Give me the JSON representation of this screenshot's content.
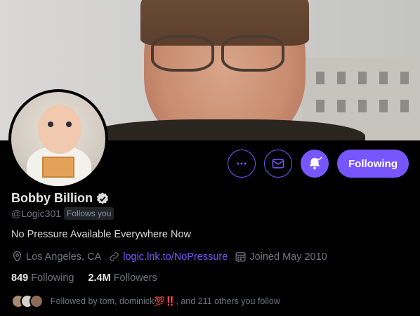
{
  "profile": {
    "display_name": "Bobby Billion",
    "handle": "@Logic301",
    "follows_you": "Follows you",
    "bio": "No Pressure Available Everywhere Now",
    "location": "Los Angeles, CA",
    "link": "logic.lnk.to/NoPressure",
    "joined": "Joined May 2010"
  },
  "stats": {
    "following_count": "849",
    "following_label": "Following",
    "followers_count": "2.4M",
    "followers_label": "Followers"
  },
  "followed_by": {
    "text": "Followed by tom, dominick",
    "emoji": "💯‼️",
    "suffix": ", and 211 others you follow"
  },
  "actions": {
    "follow_button_label": "Following"
  },
  "colors": {
    "accent": "#7856ff",
    "background": "#000000",
    "secondary_text": "#6e767d"
  },
  "icons": [
    "more-icon",
    "mail-icon",
    "bell-icon",
    "verified-badge-icon",
    "location-icon",
    "link-icon",
    "calendar-icon"
  ]
}
